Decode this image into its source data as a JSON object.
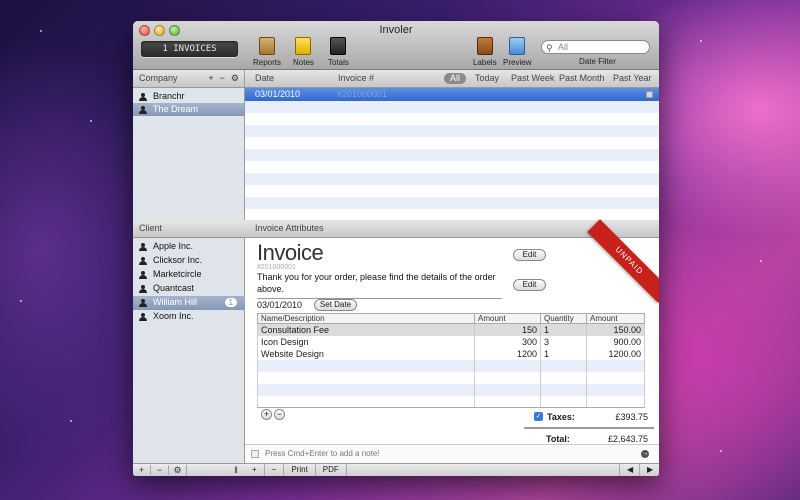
{
  "window": {
    "title": "Involer"
  },
  "toolbar": {
    "invoice_count": "1 INVOICES",
    "reports": "Reports",
    "notes": "Notes",
    "totals": "Totals",
    "labels": "Labels",
    "preview": "Preview",
    "search_placeholder": "All",
    "date_filter": "Date Filter"
  },
  "company": {
    "header": "Company",
    "items": [
      {
        "label": "Branchr",
        "selected": false
      },
      {
        "label": "The Dream",
        "selected": true
      }
    ]
  },
  "invoice_list": {
    "columns": {
      "date": "Date",
      "number": "Invoice #"
    },
    "filters": [
      "All",
      "Today",
      "Past Week",
      "Past Month",
      "Past Year"
    ],
    "rows": [
      {
        "date": "03/01/2010",
        "number": "#201000001"
      }
    ]
  },
  "client": {
    "header": "Client",
    "items": [
      {
        "label": "Apple Inc."
      },
      {
        "label": "Clicksor Inc."
      },
      {
        "label": "Marketcircle"
      },
      {
        "label": "Quantcast"
      },
      {
        "label": "William Hill",
        "badge": "1",
        "selected": true
      },
      {
        "label": "Xoom Inc."
      }
    ]
  },
  "attributes": {
    "header": "Invoice Attributes",
    "title": "Invoice",
    "number": "#201000001",
    "message": "Thank you for your order, please find the details of the order above.",
    "edit_label": "Edit",
    "date": "03/01/2010",
    "set_date": "Set Date",
    "status": "UNPAID",
    "table": {
      "headers": [
        "Name/Description",
        "Amount",
        "Quantity",
        "Amount"
      ],
      "rows": [
        [
          "Consultation Fee",
          "150",
          "1",
          "150.00"
        ],
        [
          "Icon Design",
          "300",
          "3",
          "900.00"
        ],
        [
          "Website Design",
          "1200",
          "1",
          "1200.00"
        ]
      ]
    },
    "taxes_label": "Taxes:",
    "taxes_value": "£393.75",
    "total_label": "Total:",
    "total_value": "£2,643.75",
    "note_placeholder": "Press Cmd+Enter to add a note!"
  },
  "footer": {
    "print": "Print",
    "pdf": "PDF",
    "add": "+",
    "remove": "−"
  }
}
